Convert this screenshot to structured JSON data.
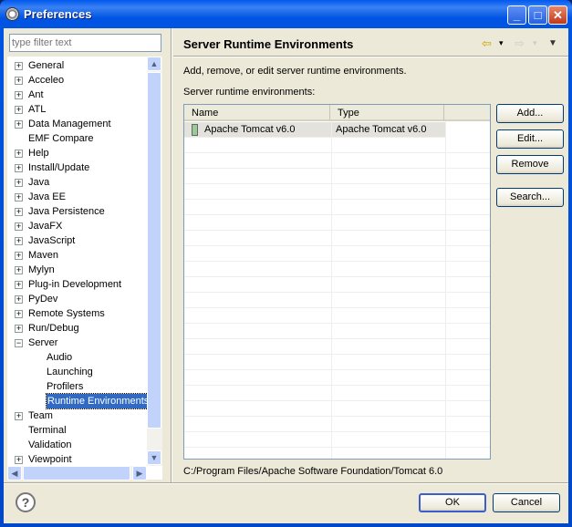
{
  "window": {
    "title": "Preferences",
    "min": "_",
    "max": "□",
    "close": "✕"
  },
  "filter": {
    "placeholder": "type filter text"
  },
  "tree": [
    {
      "label": "General",
      "exp": "+",
      "lvl": 0
    },
    {
      "label": "Acceleo",
      "exp": "+",
      "lvl": 0
    },
    {
      "label": "Ant",
      "exp": "+",
      "lvl": 0
    },
    {
      "label": "ATL",
      "exp": "+",
      "lvl": 0
    },
    {
      "label": "Data Management",
      "exp": "+",
      "lvl": 0
    },
    {
      "label": "EMF Compare",
      "exp": "",
      "lvl": 0
    },
    {
      "label": "Help",
      "exp": "+",
      "lvl": 0
    },
    {
      "label": "Install/Update",
      "exp": "+",
      "lvl": 0
    },
    {
      "label": "Java",
      "exp": "+",
      "lvl": 0
    },
    {
      "label": "Java EE",
      "exp": "+",
      "lvl": 0
    },
    {
      "label": "Java Persistence",
      "exp": "+",
      "lvl": 0
    },
    {
      "label": "JavaFX",
      "exp": "+",
      "lvl": 0
    },
    {
      "label": "JavaScript",
      "exp": "+",
      "lvl": 0
    },
    {
      "label": "Maven",
      "exp": "+",
      "lvl": 0
    },
    {
      "label": "Mylyn",
      "exp": "+",
      "lvl": 0
    },
    {
      "label": "Plug-in Development",
      "exp": "+",
      "lvl": 0
    },
    {
      "label": "PyDev",
      "exp": "+",
      "lvl": 0
    },
    {
      "label": "Remote Systems",
      "exp": "+",
      "lvl": 0
    },
    {
      "label": "Run/Debug",
      "exp": "+",
      "lvl": 0
    },
    {
      "label": "Server",
      "exp": "-",
      "lvl": 0
    },
    {
      "label": "Audio",
      "exp": "",
      "lvl": 1
    },
    {
      "label": "Launching",
      "exp": "",
      "lvl": 1
    },
    {
      "label": "Profilers",
      "exp": "",
      "lvl": 1
    },
    {
      "label": "Runtime Environments",
      "exp": "",
      "lvl": 1,
      "selected": true
    },
    {
      "label": "Team",
      "exp": "+",
      "lvl": 0
    },
    {
      "label": "Terminal",
      "exp": "",
      "lvl": 0
    },
    {
      "label": "Validation",
      "exp": "",
      "lvl": 0
    },
    {
      "label": "Viewpoint",
      "exp": "+",
      "lvl": 0
    }
  ],
  "page": {
    "title": "Server Runtime Environments",
    "description": "Add, remove, or edit server runtime environments.",
    "list_label": "Server runtime environments:",
    "path": "C:/Program Files/Apache Software Foundation/Tomcat 6.0"
  },
  "table": {
    "columns": [
      "Name",
      "Type"
    ],
    "rows": [
      {
        "name": "Apache Tomcat v6.0",
        "type": "Apache Tomcat v6.0"
      }
    ]
  },
  "buttons": {
    "add": "Add...",
    "edit": "Edit...",
    "remove": "Remove",
    "search": "Search...",
    "ok": "OK",
    "cancel": "Cancel",
    "help": "?"
  },
  "nav": {
    "back": "⇦",
    "forward": "⇨",
    "menu": "▼",
    "dropdown": "▾"
  }
}
